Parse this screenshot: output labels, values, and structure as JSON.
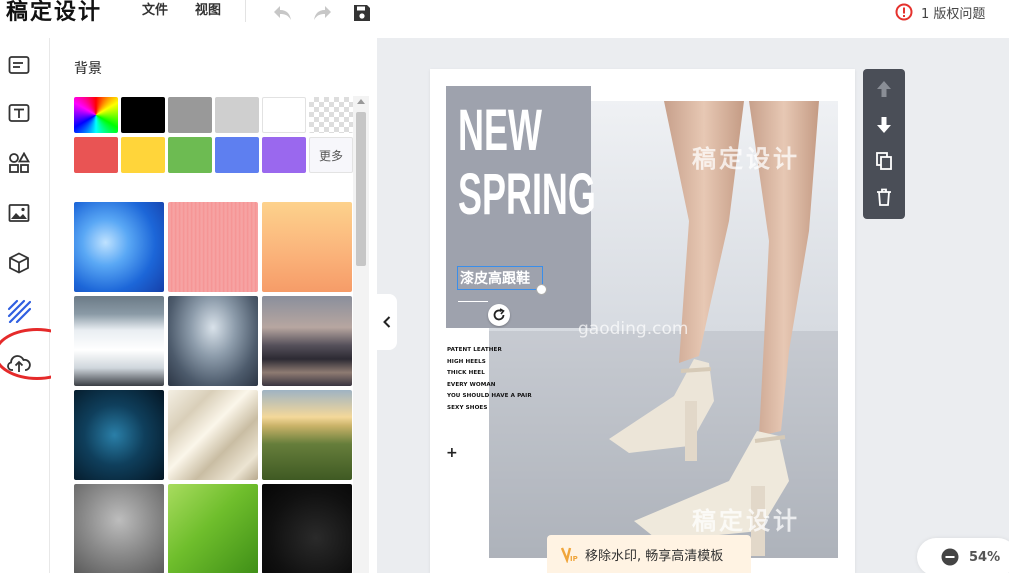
{
  "app": {
    "name": "稿定设计"
  },
  "menu": {
    "file": "文件",
    "view": "视图"
  },
  "warning": {
    "text": "1 版权问题",
    "color": "#e5322d"
  },
  "panel": {
    "title": "背景",
    "more_label": "更多",
    "colors": [
      "#000000",
      "#999999",
      "#cfcfcf",
      "#ffffff",
      "#e95454",
      "#ffd53a",
      "#6dbb52",
      "#5e7ff0",
      "#9a68ee"
    ]
  },
  "editor": {
    "headline_1": "NEW",
    "headline_2": "SPRING",
    "subtitle": "漆皮高跟鞋",
    "taglines": [
      "PATENT LEATHER",
      "HIGH HEELS",
      "THICK HEEL",
      "EVERY WOMAN",
      "YOU SHOULD HAVE A PAIR",
      "SEXY SHOES"
    ],
    "plus": "+",
    "watermark_text": "稿定设计",
    "watermark_url": "gaoding.com"
  },
  "vip": {
    "text": "移除水印, 畅享高清模板"
  },
  "zoom": {
    "value": "54%"
  }
}
